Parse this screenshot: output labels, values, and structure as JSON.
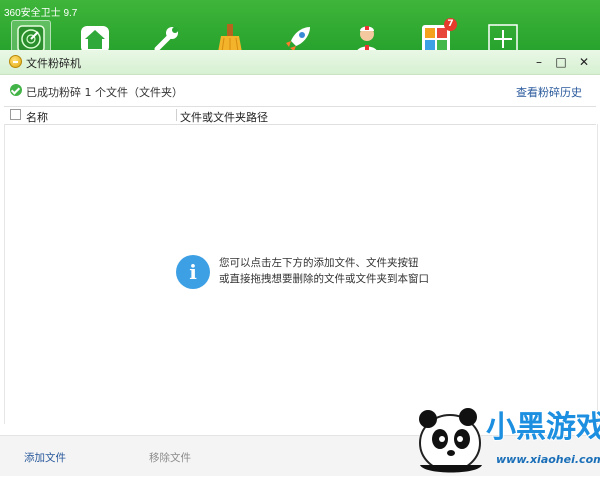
{
  "app": {
    "title": "360安全卫士 9.7",
    "brand_color": "#2fae33",
    "toolbar": [
      {
        "name": "radar-icon",
        "active": true
      },
      {
        "name": "house-shield-icon"
      },
      {
        "name": "wrench-icon"
      },
      {
        "name": "broom-icon"
      },
      {
        "name": "rocket-icon"
      },
      {
        "name": "doctor-icon"
      },
      {
        "name": "app-store-icon",
        "badge": "7"
      },
      {
        "name": "plus-icon"
      }
    ]
  },
  "dialog": {
    "title": "文件粉碎机",
    "window_controls": {
      "minimize": "–",
      "maximize": "□",
      "close": "✕"
    }
  },
  "status": {
    "text": "已成功粉碎 1 个文件（文件夹）",
    "history_link": "查看粉碎历史"
  },
  "table": {
    "columns": [
      "名称",
      "文件或文件夹路径"
    ],
    "rows": []
  },
  "empty_hint": {
    "line1": "您可以点击左下方的添加文件、文件夹按钮",
    "line2": "或直接拖拽想要删除的文件或文件夹到本窗口"
  },
  "footer": {
    "add_label": "添加文件",
    "remove_label": "移除文件"
  },
  "watermark": {
    "brand": "小黑游戏",
    "url": "www.xiaohei.com"
  }
}
